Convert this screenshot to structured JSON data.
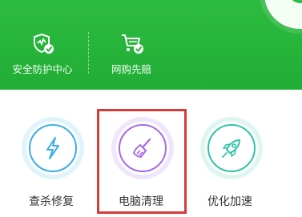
{
  "header": {
    "items": [
      {
        "label": "安全防护中心",
        "icon": "shield-check-icon"
      },
      {
        "label": "网购先赔",
        "icon": "shopping-cart-check-icon"
      }
    ]
  },
  "tools": [
    {
      "label": "查杀修复",
      "icon": "lightning-icon",
      "color": "#3aaee8"
    },
    {
      "label": "电脑清理",
      "icon": "broom-icon",
      "color": "#a56ae8"
    },
    {
      "label": "优化加速",
      "icon": "rocket-icon",
      "color": "#2ec5a6"
    }
  ],
  "colors": {
    "header_green": "#26b33a",
    "highlight_red": "#d63a3a"
  }
}
